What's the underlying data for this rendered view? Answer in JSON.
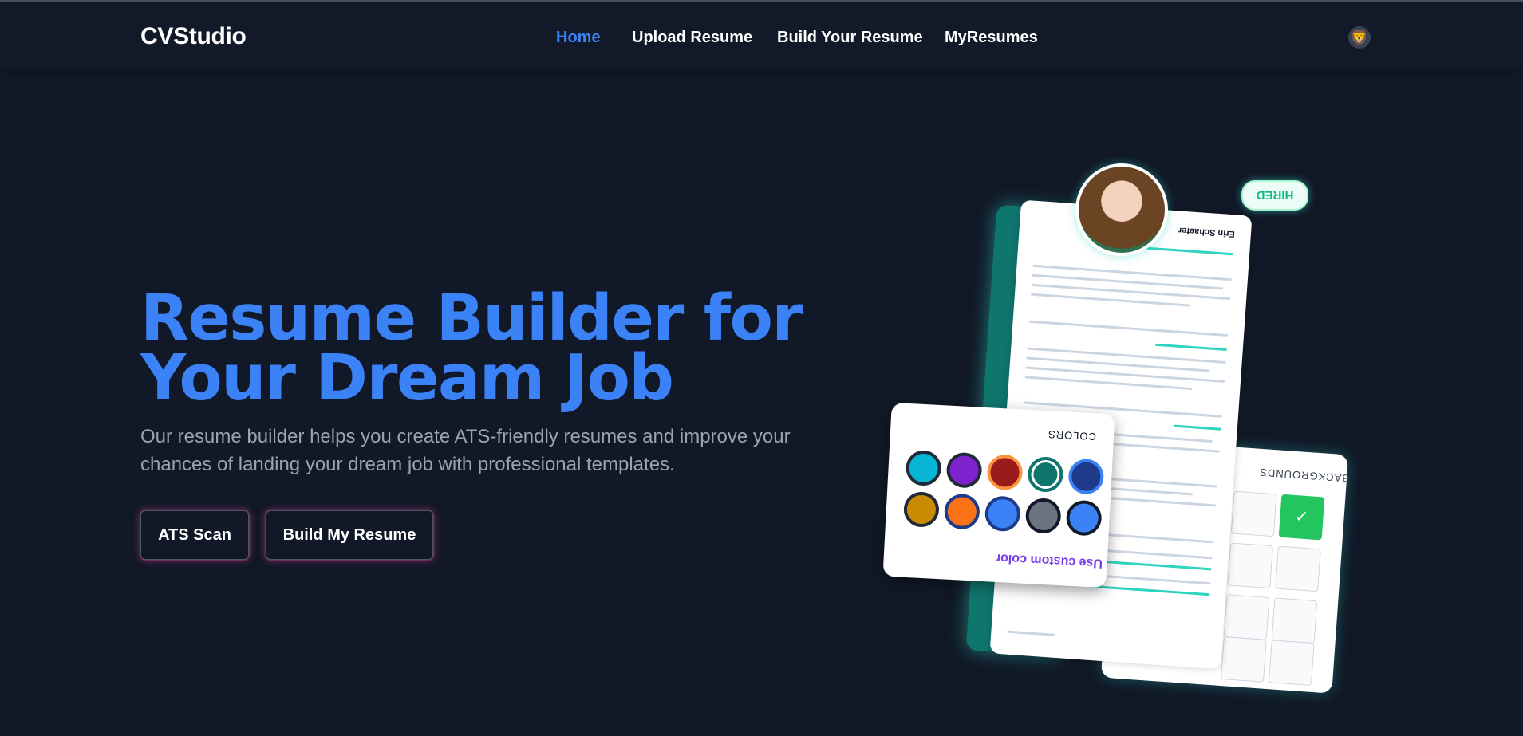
{
  "nav": {
    "brand": "CVStudio",
    "links": [
      {
        "label": "Home",
        "active": true
      },
      {
        "label": "Upload Resume",
        "active": false
      },
      {
        "label": "Build Your Resume",
        "active": false
      },
      {
        "label": "MyResumes",
        "active": false
      }
    ],
    "avatar_icon": "🦁"
  },
  "hero": {
    "title_line1": "Resume Builder for",
    "title_line2": "Your Dream Job",
    "subtitle": "Our resume builder helps you create ATS-friendly resumes and improve your chances of landing your dream job with professional templates.",
    "buttons": {
      "ats": "ATS Scan",
      "build": "Build My Resume"
    }
  },
  "illustration": {
    "hired_badge": "HIRED",
    "resume_name": "Erin Schaefer",
    "colors_title": "COLORS",
    "custom_color": "Use custom color",
    "backgrounds_title": "BACKGROUNDS",
    "swatches": [
      "#06b6d4",
      "#7e22ce",
      "#991b1b",
      "#0f766e",
      "#1e3a8a",
      "#ca8a04",
      "#f97316",
      "#3b82f6",
      "#6b7280",
      "#3b82f6"
    ]
  },
  "colors": {
    "accent": "#3b82f6",
    "background": "#111827",
    "button_glow": "#ec4899"
  }
}
